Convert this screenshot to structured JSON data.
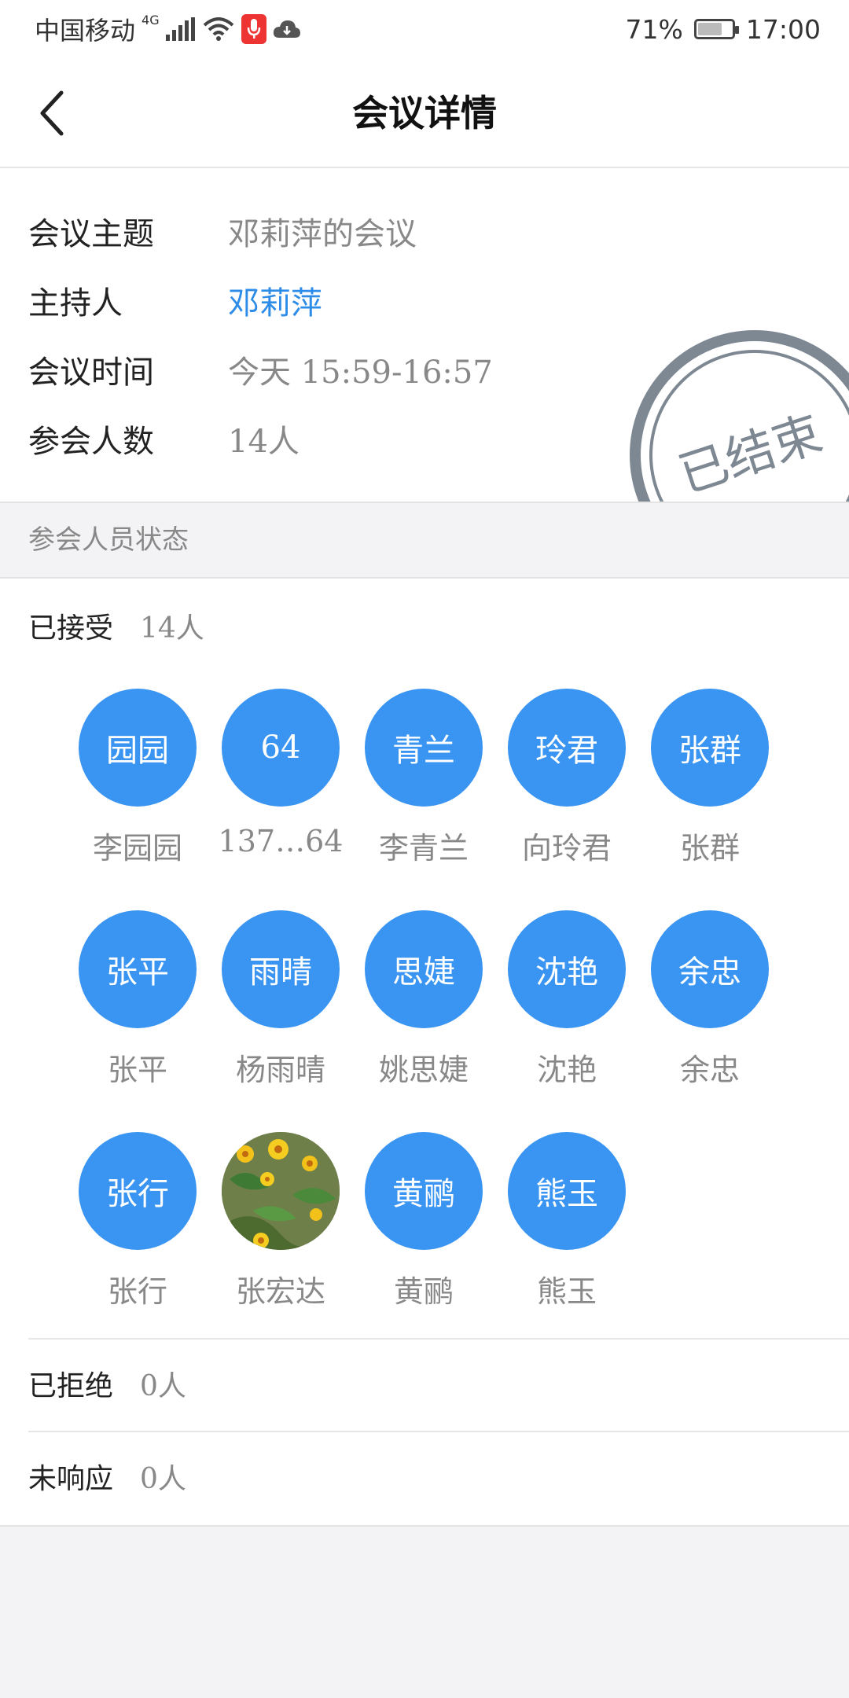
{
  "status_bar": {
    "carrier": "中国移动",
    "network": "4G",
    "battery": "71%",
    "battery_level": 0.71,
    "time": "17:00"
  },
  "nav": {
    "title": "会议详情"
  },
  "meeting": {
    "topic_label": "会议主题",
    "topic": "邓莉萍的会议",
    "host_label": "主持人",
    "host": "邓莉萍",
    "time_label": "会议时间",
    "time": "今天 15:59-16:57",
    "count_label": "参会人数",
    "count": "14人",
    "stamp": "已结束"
  },
  "participants": {
    "section_title": "参会人员状态",
    "accepted_label": "已接受",
    "accepted_count": "14人",
    "rejected_label": "已拒绝",
    "rejected_count": "0人",
    "pending_label": "未响应",
    "pending_count": "0人",
    "list": [
      {
        "avatar": "园园",
        "name": "李园园"
      },
      {
        "avatar": "64",
        "name": "137…64"
      },
      {
        "avatar": "青兰",
        "name": "李青兰"
      },
      {
        "avatar": "玲君",
        "name": "向玲君"
      },
      {
        "avatar": "张群",
        "name": "张群"
      },
      {
        "avatar": "张平",
        "name": "张平"
      },
      {
        "avatar": "雨晴",
        "name": "杨雨晴"
      },
      {
        "avatar": "思婕",
        "name": "姚思婕"
      },
      {
        "avatar": "沈艳",
        "name": "沈艳"
      },
      {
        "avatar": "余忠",
        "name": "余忠"
      },
      {
        "avatar": "张行",
        "name": "张行"
      },
      {
        "avatar": "",
        "name": "张宏达"
      },
      {
        "avatar": "黄鹂",
        "name": "黄鹂"
      },
      {
        "avatar": "熊玉",
        "name": "熊玉"
      }
    ]
  },
  "colors": {
    "accent": "#3a95f2",
    "link": "#2d8ce8",
    "stamp": "#7e8893"
  }
}
